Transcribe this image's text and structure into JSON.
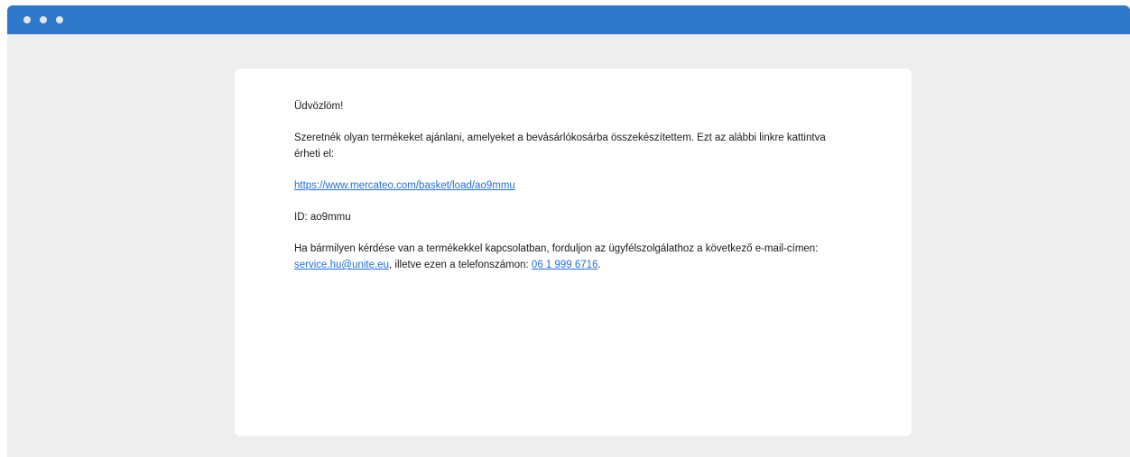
{
  "window": {
    "controls": [
      "close",
      "minimize",
      "maximize"
    ]
  },
  "email": {
    "greeting": "Üdvözlöm!",
    "intro": "Szeretnék olyan termékeket ajánlani, amelyeket a bevásárlókosárba összekészítettem. Ezt az alábbi linkre kattintva érheti el:",
    "basket_link": "https://www.mercateo.com/basket/load/ao9mmu",
    "id_line": "ID: ao9mmu",
    "contact_prefix": "Ha bármilyen kérdése van a termékekkel kapcsolatban, forduljon az ügyfélszolgálathoz a következő e-mail-címen: ",
    "service_email": "service.hu@unite.eu",
    "contact_middle": ", illetve ezen a telefonszámon: ",
    "phone": "06 1 999 6716",
    "contact_suffix": "."
  },
  "colors": {
    "titlebar": "#2f78cc",
    "background": "#eeeeee",
    "link": "#1f6fe0"
  }
}
